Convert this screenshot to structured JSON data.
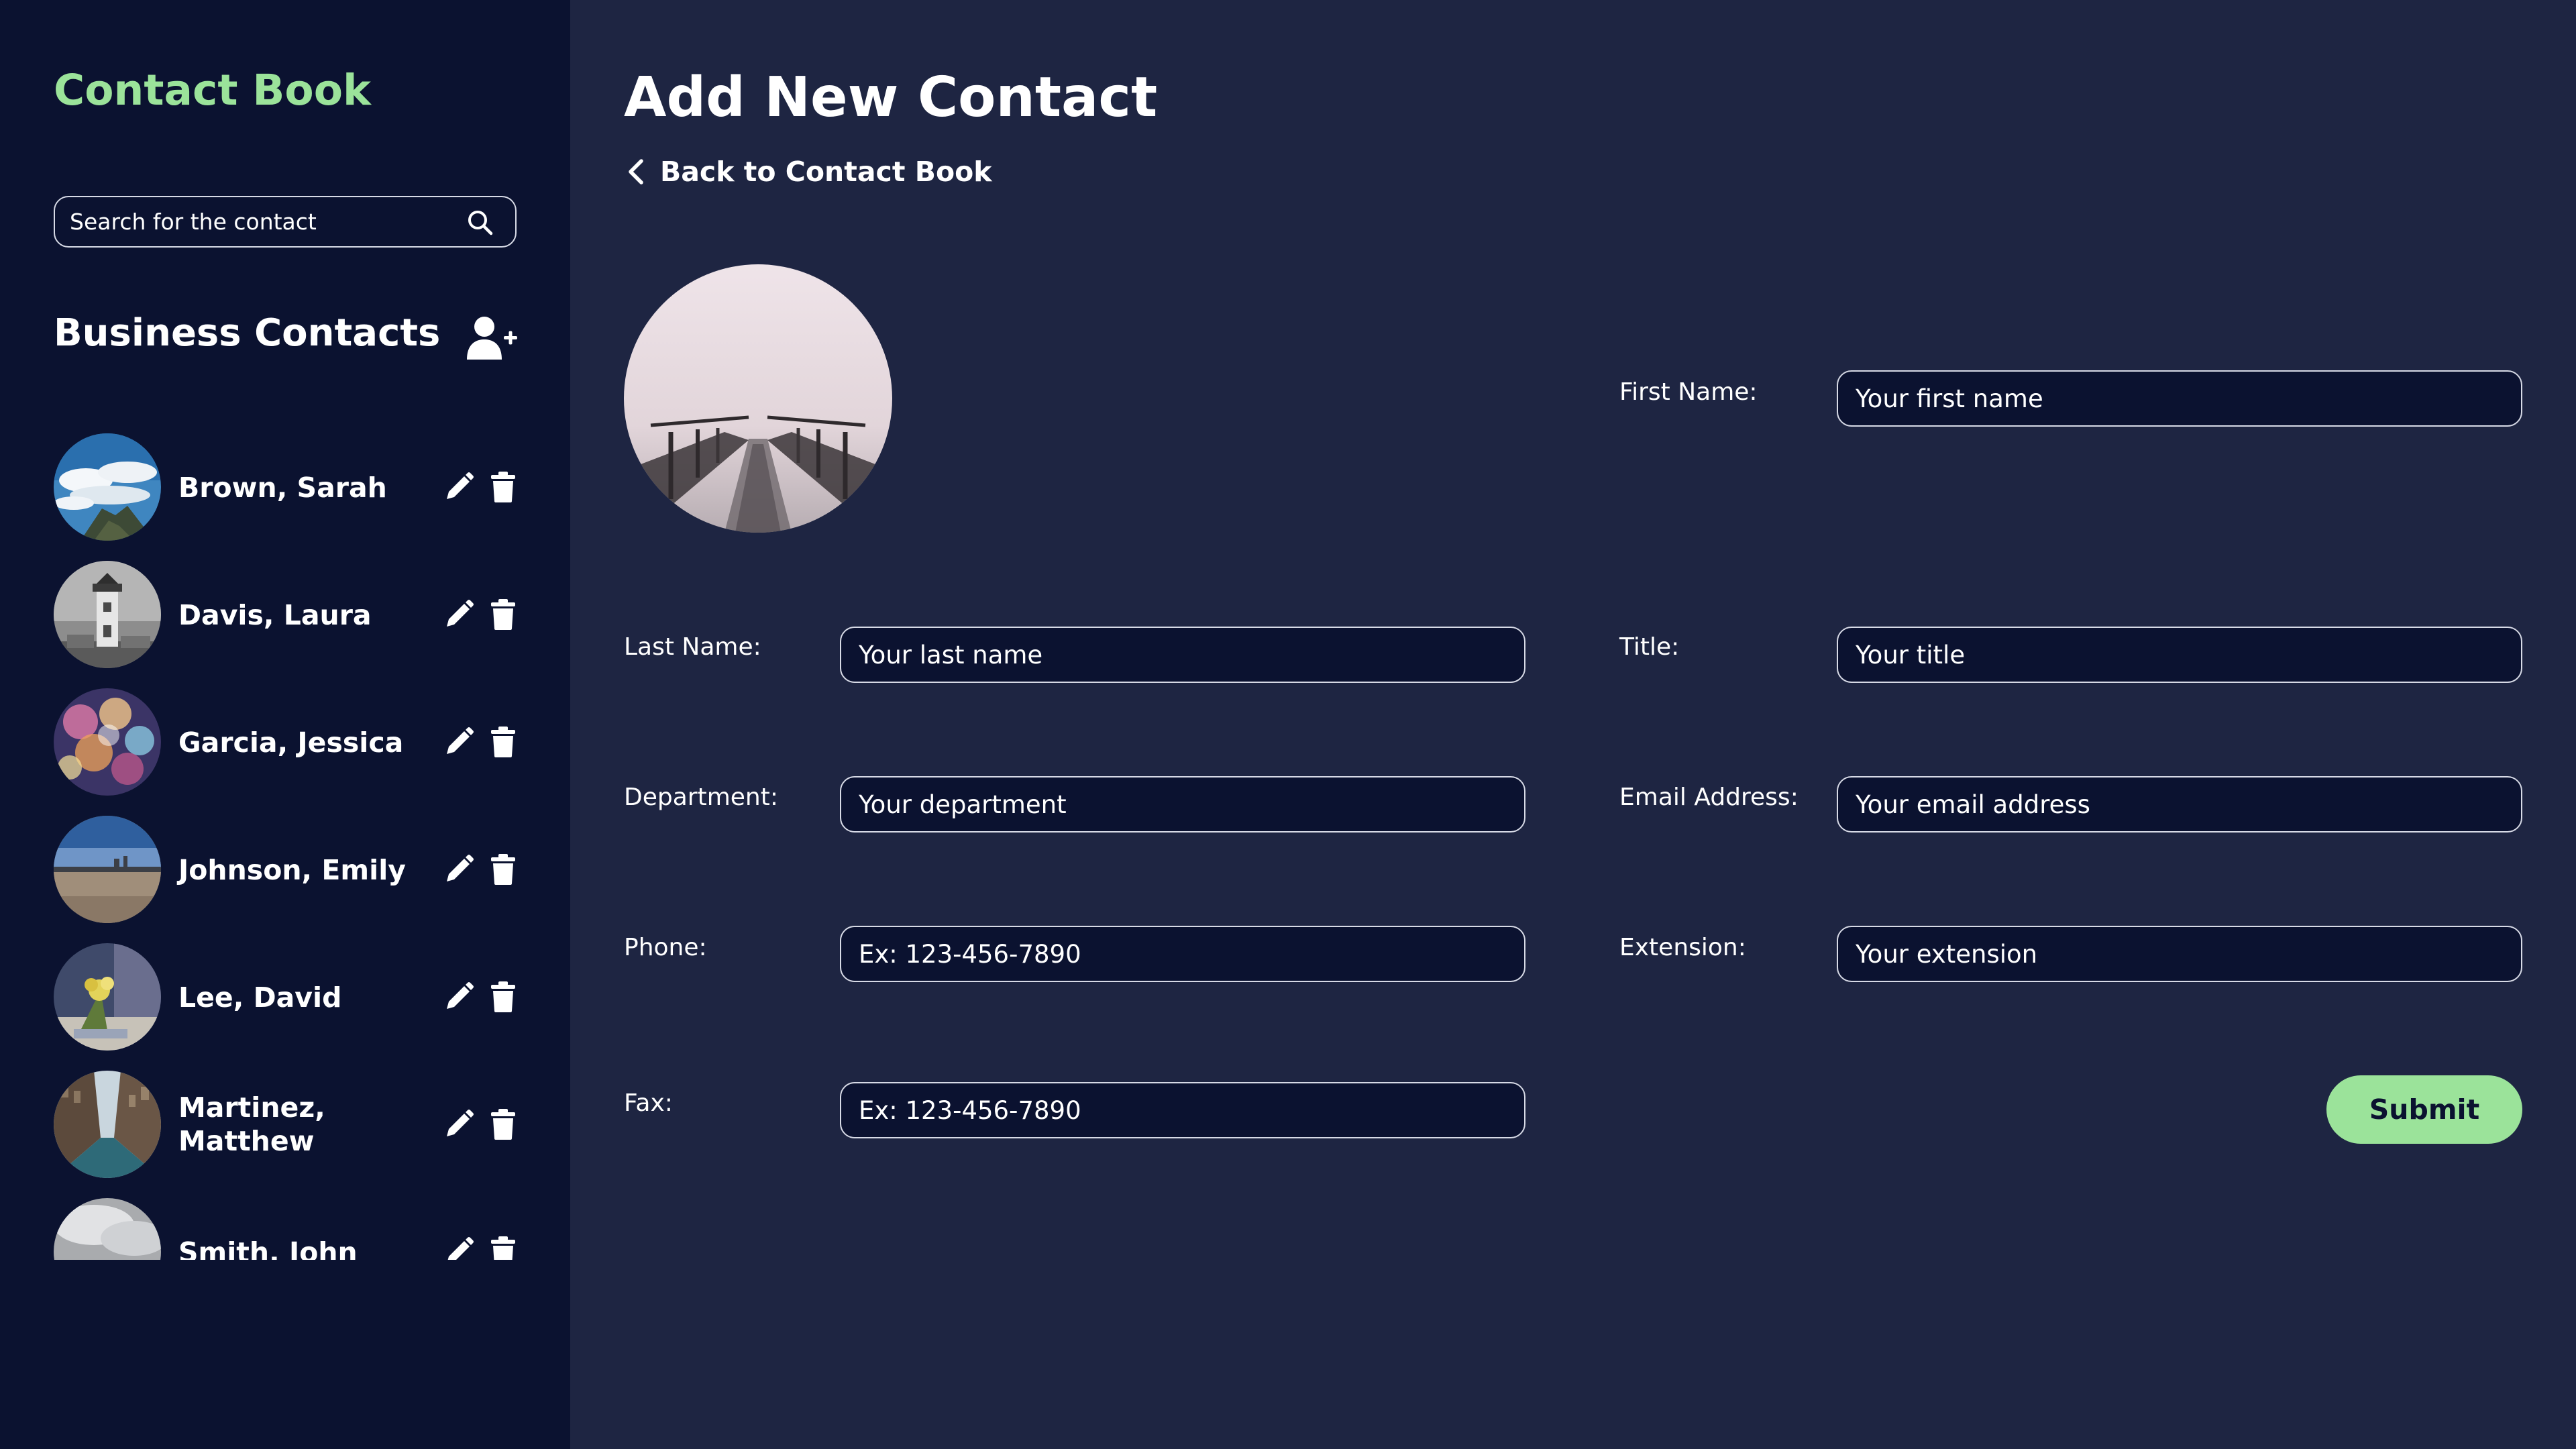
{
  "colors": {
    "accent": "#9be39a",
    "sidebar_bg": "#0b1230",
    "main_bg": "#1e2542",
    "input_border": "#d7dae6"
  },
  "sidebar": {
    "app_title": "Contact Book",
    "search": {
      "placeholder": "Search for the contact",
      "icon": "search-icon"
    },
    "section_title": "Business Contacts",
    "add_contact_icon": "add-user-icon",
    "contacts": [
      {
        "name": "Brown, Sarah",
        "avatar": "sky-clouds-photo"
      },
      {
        "name": "Davis, Laura",
        "avatar": "lighthouse-photo"
      },
      {
        "name": "Garcia, Jessica",
        "avatar": "bokeh-lights-photo"
      },
      {
        "name": "Johnson, Emily",
        "avatar": "beach-photo"
      },
      {
        "name": "Lee, David",
        "avatar": "flower-photo"
      },
      {
        "name": "Martinez, Matthew",
        "avatar": "city-street-photo"
      },
      {
        "name": "Smith, John",
        "avatar": "cloudy-sky-photo"
      }
    ]
  },
  "main": {
    "page_title": "Add New Contact",
    "back_link": "Back to Contact Book",
    "photo": "foggy-pier-photo",
    "fields": {
      "first_name": {
        "label": "First Name:",
        "placeholder": "Your first name"
      },
      "last_name": {
        "label": "Last Name:",
        "placeholder": "Your last name"
      },
      "title": {
        "label": "Title:",
        "placeholder": "Your title"
      },
      "department": {
        "label": "Department:",
        "placeholder": "Your department"
      },
      "email": {
        "label": "Email Address:",
        "placeholder": "Your email address"
      },
      "phone": {
        "label": "Phone:",
        "placeholder": "Ex: 123-456-7890"
      },
      "extension": {
        "label": "Extension:",
        "placeholder": "Your extension"
      },
      "fax": {
        "label": "Fax:",
        "placeholder": "Ex: 123-456-7890"
      }
    },
    "submit_label": "Submit"
  }
}
